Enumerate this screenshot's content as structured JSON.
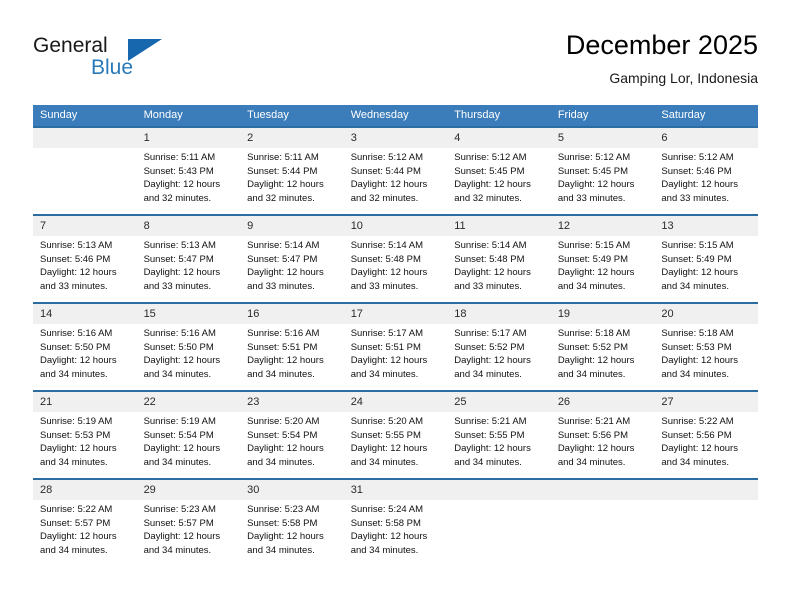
{
  "brand": {
    "name_part1": "General",
    "name_part2": "Blue",
    "triangle_color": "#1667ad",
    "blue_color": "#2a7ab9"
  },
  "header": {
    "month_title": "December 2025",
    "location": "Gamping Lor, Indonesia"
  },
  "theme": {
    "header_bg": "#3b7cba",
    "row_border": "#2b6ca3",
    "daynum_bg": "#f0f0f0"
  },
  "weekday_headers": [
    "Sunday",
    "Monday",
    "Tuesday",
    "Wednesday",
    "Thursday",
    "Friday",
    "Saturday"
  ],
  "weeks": [
    [
      {
        "day": "",
        "sunrise": "",
        "sunset": "",
        "daylight1": "",
        "daylight2": "",
        "empty": true
      },
      {
        "day": "1",
        "sunrise": "Sunrise: 5:11 AM",
        "sunset": "Sunset: 5:43 PM",
        "daylight1": "Daylight: 12 hours",
        "daylight2": "and 32 minutes.",
        "empty": false
      },
      {
        "day": "2",
        "sunrise": "Sunrise: 5:11 AM",
        "sunset": "Sunset: 5:44 PM",
        "daylight1": "Daylight: 12 hours",
        "daylight2": "and 32 minutes.",
        "empty": false
      },
      {
        "day": "3",
        "sunrise": "Sunrise: 5:12 AM",
        "sunset": "Sunset: 5:44 PM",
        "daylight1": "Daylight: 12 hours",
        "daylight2": "and 32 minutes.",
        "empty": false
      },
      {
        "day": "4",
        "sunrise": "Sunrise: 5:12 AM",
        "sunset": "Sunset: 5:45 PM",
        "daylight1": "Daylight: 12 hours",
        "daylight2": "and 32 minutes.",
        "empty": false
      },
      {
        "day": "5",
        "sunrise": "Sunrise: 5:12 AM",
        "sunset": "Sunset: 5:45 PM",
        "daylight1": "Daylight: 12 hours",
        "daylight2": "and 33 minutes.",
        "empty": false
      },
      {
        "day": "6",
        "sunrise": "Sunrise: 5:12 AM",
        "sunset": "Sunset: 5:46 PM",
        "daylight1": "Daylight: 12 hours",
        "daylight2": "and 33 minutes.",
        "empty": false
      }
    ],
    [
      {
        "day": "7",
        "sunrise": "Sunrise: 5:13 AM",
        "sunset": "Sunset: 5:46 PM",
        "daylight1": "Daylight: 12 hours",
        "daylight2": "and 33 minutes.",
        "empty": false
      },
      {
        "day": "8",
        "sunrise": "Sunrise: 5:13 AM",
        "sunset": "Sunset: 5:47 PM",
        "daylight1": "Daylight: 12 hours",
        "daylight2": "and 33 minutes.",
        "empty": false
      },
      {
        "day": "9",
        "sunrise": "Sunrise: 5:14 AM",
        "sunset": "Sunset: 5:47 PM",
        "daylight1": "Daylight: 12 hours",
        "daylight2": "and 33 minutes.",
        "empty": false
      },
      {
        "day": "10",
        "sunrise": "Sunrise: 5:14 AM",
        "sunset": "Sunset: 5:48 PM",
        "daylight1": "Daylight: 12 hours",
        "daylight2": "and 33 minutes.",
        "empty": false
      },
      {
        "day": "11",
        "sunrise": "Sunrise: 5:14 AM",
        "sunset": "Sunset: 5:48 PM",
        "daylight1": "Daylight: 12 hours",
        "daylight2": "and 33 minutes.",
        "empty": false
      },
      {
        "day": "12",
        "sunrise": "Sunrise: 5:15 AM",
        "sunset": "Sunset: 5:49 PM",
        "daylight1": "Daylight: 12 hours",
        "daylight2": "and 34 minutes.",
        "empty": false
      },
      {
        "day": "13",
        "sunrise": "Sunrise: 5:15 AM",
        "sunset": "Sunset: 5:49 PM",
        "daylight1": "Daylight: 12 hours",
        "daylight2": "and 34 minutes.",
        "empty": false
      }
    ],
    [
      {
        "day": "14",
        "sunrise": "Sunrise: 5:16 AM",
        "sunset": "Sunset: 5:50 PM",
        "daylight1": "Daylight: 12 hours",
        "daylight2": "and 34 minutes.",
        "empty": false
      },
      {
        "day": "15",
        "sunrise": "Sunrise: 5:16 AM",
        "sunset": "Sunset: 5:50 PM",
        "daylight1": "Daylight: 12 hours",
        "daylight2": "and 34 minutes.",
        "empty": false
      },
      {
        "day": "16",
        "sunrise": "Sunrise: 5:16 AM",
        "sunset": "Sunset: 5:51 PM",
        "daylight1": "Daylight: 12 hours",
        "daylight2": "and 34 minutes.",
        "empty": false
      },
      {
        "day": "17",
        "sunrise": "Sunrise: 5:17 AM",
        "sunset": "Sunset: 5:51 PM",
        "daylight1": "Daylight: 12 hours",
        "daylight2": "and 34 minutes.",
        "empty": false
      },
      {
        "day": "18",
        "sunrise": "Sunrise: 5:17 AM",
        "sunset": "Sunset: 5:52 PM",
        "daylight1": "Daylight: 12 hours",
        "daylight2": "and 34 minutes.",
        "empty": false
      },
      {
        "day": "19",
        "sunrise": "Sunrise: 5:18 AM",
        "sunset": "Sunset: 5:52 PM",
        "daylight1": "Daylight: 12 hours",
        "daylight2": "and 34 minutes.",
        "empty": false
      },
      {
        "day": "20",
        "sunrise": "Sunrise: 5:18 AM",
        "sunset": "Sunset: 5:53 PM",
        "daylight1": "Daylight: 12 hours",
        "daylight2": "and 34 minutes.",
        "empty": false
      }
    ],
    [
      {
        "day": "21",
        "sunrise": "Sunrise: 5:19 AM",
        "sunset": "Sunset: 5:53 PM",
        "daylight1": "Daylight: 12 hours",
        "daylight2": "and 34 minutes.",
        "empty": false
      },
      {
        "day": "22",
        "sunrise": "Sunrise: 5:19 AM",
        "sunset": "Sunset: 5:54 PM",
        "daylight1": "Daylight: 12 hours",
        "daylight2": "and 34 minutes.",
        "empty": false
      },
      {
        "day": "23",
        "sunrise": "Sunrise: 5:20 AM",
        "sunset": "Sunset: 5:54 PM",
        "daylight1": "Daylight: 12 hours",
        "daylight2": "and 34 minutes.",
        "empty": false
      },
      {
        "day": "24",
        "sunrise": "Sunrise: 5:20 AM",
        "sunset": "Sunset: 5:55 PM",
        "daylight1": "Daylight: 12 hours",
        "daylight2": "and 34 minutes.",
        "empty": false
      },
      {
        "day": "25",
        "sunrise": "Sunrise: 5:21 AM",
        "sunset": "Sunset: 5:55 PM",
        "daylight1": "Daylight: 12 hours",
        "daylight2": "and 34 minutes.",
        "empty": false
      },
      {
        "day": "26",
        "sunrise": "Sunrise: 5:21 AM",
        "sunset": "Sunset: 5:56 PM",
        "daylight1": "Daylight: 12 hours",
        "daylight2": "and 34 minutes.",
        "empty": false
      },
      {
        "day": "27",
        "sunrise": "Sunrise: 5:22 AM",
        "sunset": "Sunset: 5:56 PM",
        "daylight1": "Daylight: 12 hours",
        "daylight2": "and 34 minutes.",
        "empty": false
      }
    ],
    [
      {
        "day": "28",
        "sunrise": "Sunrise: 5:22 AM",
        "sunset": "Sunset: 5:57 PM",
        "daylight1": "Daylight: 12 hours",
        "daylight2": "and 34 minutes.",
        "empty": false
      },
      {
        "day": "29",
        "sunrise": "Sunrise: 5:23 AM",
        "sunset": "Sunset: 5:57 PM",
        "daylight1": "Daylight: 12 hours",
        "daylight2": "and 34 minutes.",
        "empty": false
      },
      {
        "day": "30",
        "sunrise": "Sunrise: 5:23 AM",
        "sunset": "Sunset: 5:58 PM",
        "daylight1": "Daylight: 12 hours",
        "daylight2": "and 34 minutes.",
        "empty": false
      },
      {
        "day": "31",
        "sunrise": "Sunrise: 5:24 AM",
        "sunset": "Sunset: 5:58 PM",
        "daylight1": "Daylight: 12 hours",
        "daylight2": "and 34 minutes.",
        "empty": false
      },
      {
        "day": "",
        "sunrise": "",
        "sunset": "",
        "daylight1": "",
        "daylight2": "",
        "empty": true
      },
      {
        "day": "",
        "sunrise": "",
        "sunset": "",
        "daylight1": "",
        "daylight2": "",
        "empty": true
      },
      {
        "day": "",
        "sunrise": "",
        "sunset": "",
        "daylight1": "",
        "daylight2": "",
        "empty": true
      }
    ]
  ]
}
